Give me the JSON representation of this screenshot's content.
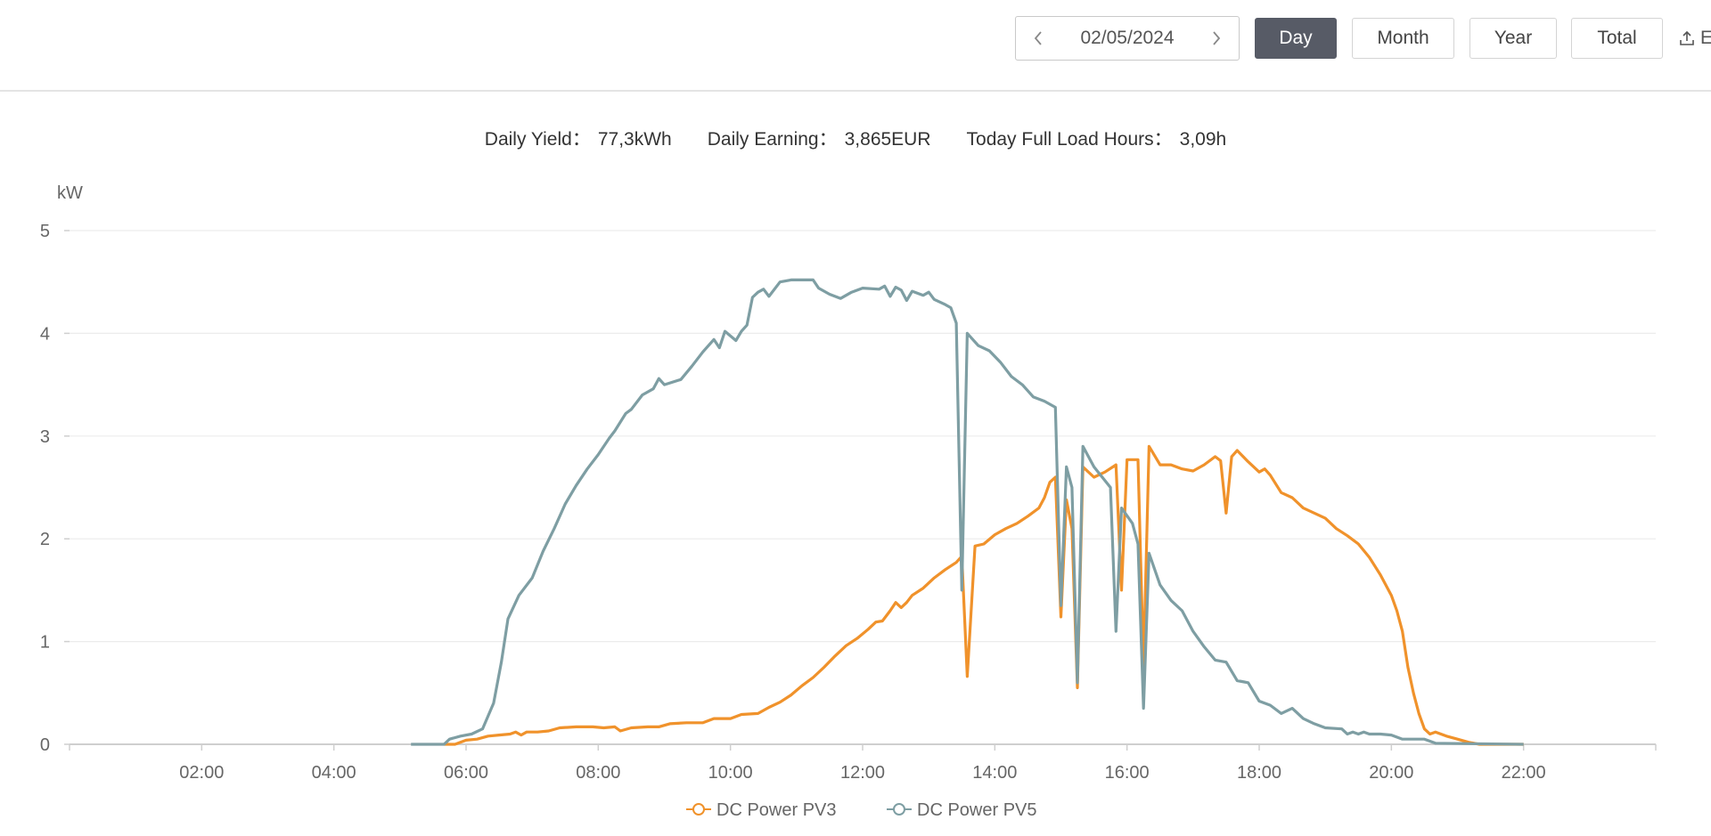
{
  "toolbar": {
    "date": "02/05/2024",
    "buttons": {
      "day": "Day",
      "month": "Month",
      "year": "Year",
      "total": "Total"
    },
    "export_label": "E"
  },
  "summary": {
    "daily_yield_label": "Daily Yield：",
    "daily_yield_value": "77,3kWh",
    "daily_earning_label": "Daily Earning：",
    "daily_earning_value": "3,865EUR",
    "full_load_label": "Today Full Load Hours：",
    "full_load_value": "3,09h"
  },
  "colors": {
    "pv3": "#f0922b",
    "pv5": "#7e9ea3",
    "active_button": "#575b66"
  },
  "chart_data": {
    "type": "line",
    "ylabel": "kW",
    "ylim": [
      0,
      5
    ],
    "yticks": [
      0,
      1,
      2,
      3,
      4,
      5
    ],
    "xlim": [
      "00:00",
      "24:00"
    ],
    "xticks": [
      "02:00",
      "04:00",
      "06:00",
      "08:00",
      "10:00",
      "12:00",
      "14:00",
      "16:00",
      "18:00",
      "20:00",
      "22:00"
    ],
    "grid": true,
    "legend_position": "bottom",
    "series": [
      {
        "name": "DC Power PV3",
        "color": "#f0922b",
        "points": [
          [
            "05:40",
            0.0
          ],
          [
            "05:50",
            0.0
          ],
          [
            "06:00",
            0.04
          ],
          [
            "06:10",
            0.05
          ],
          [
            "06:20",
            0.08
          ],
          [
            "06:30",
            0.09
          ],
          [
            "06:40",
            0.1
          ],
          [
            "06:45",
            0.12
          ],
          [
            "06:50",
            0.09
          ],
          [
            "06:55",
            0.12
          ],
          [
            "07:05",
            0.12
          ],
          [
            "07:15",
            0.13
          ],
          [
            "07:25",
            0.16
          ],
          [
            "07:40",
            0.17
          ],
          [
            "07:55",
            0.17
          ],
          [
            "08:05",
            0.16
          ],
          [
            "08:15",
            0.17
          ],
          [
            "08:20",
            0.13
          ],
          [
            "08:30",
            0.16
          ],
          [
            "08:45",
            0.17
          ],
          [
            "08:55",
            0.17
          ],
          [
            "09:05",
            0.2
          ],
          [
            "09:20",
            0.21
          ],
          [
            "09:35",
            0.21
          ],
          [
            "09:45",
            0.25
          ],
          [
            "10:00",
            0.25
          ],
          [
            "10:10",
            0.29
          ],
          [
            "10:25",
            0.3
          ],
          [
            "10:35",
            0.36
          ],
          [
            "10:45",
            0.41
          ],
          [
            "10:55",
            0.48
          ],
          [
            "11:05",
            0.57
          ],
          [
            "11:15",
            0.65
          ],
          [
            "11:25",
            0.75
          ],
          [
            "11:35",
            0.86
          ],
          [
            "11:45",
            0.96
          ],
          [
            "11:55",
            1.03
          ],
          [
            "12:05",
            1.12
          ],
          [
            "12:12",
            1.19
          ],
          [
            "12:18",
            1.2
          ],
          [
            "12:25",
            1.3
          ],
          [
            "12:30",
            1.38
          ],
          [
            "12:35",
            1.33
          ],
          [
            "12:40",
            1.38
          ],
          [
            "12:45",
            1.45
          ],
          [
            "12:55",
            1.52
          ],
          [
            "13:05",
            1.62
          ],
          [
            "13:15",
            1.7
          ],
          [
            "13:25",
            1.77
          ],
          [
            "13:30",
            1.83
          ],
          [
            "13:35",
            0.66
          ],
          [
            "13:42",
            1.93
          ],
          [
            "13:50",
            1.95
          ],
          [
            "14:00",
            2.04
          ],
          [
            "14:10",
            2.1
          ],
          [
            "14:20",
            2.15
          ],
          [
            "14:30",
            2.22
          ],
          [
            "14:40",
            2.3
          ],
          [
            "14:45",
            2.4
          ],
          [
            "14:50",
            2.55
          ],
          [
            "14:55",
            2.6
          ],
          [
            "15:00",
            1.24
          ],
          [
            "15:05",
            2.38
          ],
          [
            "15:10",
            2.1
          ],
          [
            "15:15",
            0.55
          ],
          [
            "15:20",
            2.7
          ],
          [
            "15:30",
            2.6
          ],
          [
            "15:40",
            2.65
          ],
          [
            "15:50",
            2.72
          ],
          [
            "15:55",
            1.5
          ],
          [
            "16:00",
            2.77
          ],
          [
            "16:10",
            2.77
          ],
          [
            "16:15",
            0.75
          ],
          [
            "16:20",
            2.9
          ],
          [
            "16:30",
            2.72
          ],
          [
            "16:40",
            2.72
          ],
          [
            "16:50",
            2.68
          ],
          [
            "17:00",
            2.66
          ],
          [
            "17:10",
            2.72
          ],
          [
            "17:20",
            2.8
          ],
          [
            "17:25",
            2.76
          ],
          [
            "17:30",
            2.25
          ],
          [
            "17:35",
            2.8
          ],
          [
            "17:40",
            2.86
          ],
          [
            "17:50",
            2.75
          ],
          [
            "18:00",
            2.65
          ],
          [
            "18:05",
            2.68
          ],
          [
            "18:10",
            2.62
          ],
          [
            "18:20",
            2.45
          ],
          [
            "18:30",
            2.4
          ],
          [
            "18:40",
            2.3
          ],
          [
            "18:50",
            2.25
          ],
          [
            "19:00",
            2.2
          ],
          [
            "19:10",
            2.1
          ],
          [
            "19:20",
            2.03
          ],
          [
            "19:30",
            1.95
          ],
          [
            "19:40",
            1.82
          ],
          [
            "19:50",
            1.65
          ],
          [
            "20:00",
            1.45
          ],
          [
            "20:05",
            1.3
          ],
          [
            "20:10",
            1.1
          ],
          [
            "20:15",
            0.75
          ],
          [
            "20:20",
            0.5
          ],
          [
            "20:25",
            0.3
          ],
          [
            "20:30",
            0.15
          ],
          [
            "20:35",
            0.1
          ],
          [
            "20:40",
            0.12
          ],
          [
            "20:50",
            0.08
          ],
          [
            "21:00",
            0.05
          ],
          [
            "21:10",
            0.02
          ],
          [
            "21:20",
            0.0
          ],
          [
            "22:00",
            0.0
          ]
        ]
      },
      {
        "name": "DC Power PV5",
        "color": "#7e9ea3",
        "points": [
          [
            "05:10",
            0.0
          ],
          [
            "05:40",
            0.0
          ],
          [
            "05:45",
            0.05
          ],
          [
            "05:55",
            0.08
          ],
          [
            "06:05",
            0.1
          ],
          [
            "06:15",
            0.15
          ],
          [
            "06:25",
            0.4
          ],
          [
            "06:32",
            0.8
          ],
          [
            "06:38",
            1.22
          ],
          [
            "06:48",
            1.45
          ],
          [
            "07:00",
            1.62
          ],
          [
            "07:10",
            1.88
          ],
          [
            "07:20",
            2.1
          ],
          [
            "07:30",
            2.34
          ],
          [
            "07:40",
            2.52
          ],
          [
            "07:50",
            2.68
          ],
          [
            "08:00",
            2.82
          ],
          [
            "08:10",
            2.98
          ],
          [
            "08:15",
            3.05
          ],
          [
            "08:25",
            3.22
          ],
          [
            "08:30",
            3.26
          ],
          [
            "08:40",
            3.4
          ],
          [
            "08:50",
            3.46
          ],
          [
            "08:55",
            3.56
          ],
          [
            "09:00",
            3.5
          ],
          [
            "09:15",
            3.55
          ],
          [
            "09:25",
            3.68
          ],
          [
            "09:35",
            3.82
          ],
          [
            "09:45",
            3.94
          ],
          [
            "09:50",
            3.86
          ],
          [
            "09:55",
            4.02
          ],
          [
            "10:05",
            3.93
          ],
          [
            "10:10",
            4.02
          ],
          [
            "10:15",
            4.08
          ],
          [
            "10:20",
            4.35
          ],
          [
            "10:25",
            4.4
          ],
          [
            "10:30",
            4.43
          ],
          [
            "10:35",
            4.36
          ],
          [
            "10:45",
            4.5
          ],
          [
            "10:55",
            4.52
          ],
          [
            "11:15",
            4.52
          ],
          [
            "11:20",
            4.44
          ],
          [
            "11:30",
            4.38
          ],
          [
            "11:40",
            4.34
          ],
          [
            "11:50",
            4.4
          ],
          [
            "12:00",
            4.44
          ],
          [
            "12:15",
            4.43
          ],
          [
            "12:20",
            4.46
          ],
          [
            "12:25",
            4.36
          ],
          [
            "12:30",
            4.45
          ],
          [
            "12:35",
            4.42
          ],
          [
            "12:40",
            4.32
          ],
          [
            "12:45",
            4.41
          ],
          [
            "12:55",
            4.37
          ],
          [
            "13:00",
            4.4
          ],
          [
            "13:05",
            4.33
          ],
          [
            "13:15",
            4.28
          ],
          [
            "13:20",
            4.25
          ],
          [
            "13:25",
            4.1
          ],
          [
            "13:30",
            1.5
          ],
          [
            "13:35",
            4.0
          ],
          [
            "13:45",
            3.88
          ],
          [
            "13:55",
            3.83
          ],
          [
            "14:05",
            3.72
          ],
          [
            "14:15",
            3.58
          ],
          [
            "14:25",
            3.5
          ],
          [
            "14:35",
            3.38
          ],
          [
            "14:45",
            3.34
          ],
          [
            "14:55",
            3.28
          ],
          [
            "15:00",
            1.35
          ],
          [
            "15:05",
            2.7
          ],
          [
            "15:10",
            2.5
          ],
          [
            "15:15",
            0.6
          ],
          [
            "15:20",
            2.9
          ],
          [
            "15:30",
            2.7
          ],
          [
            "15:45",
            2.5
          ],
          [
            "15:50",
            1.1
          ],
          [
            "15:55",
            2.3
          ],
          [
            "16:05",
            2.15
          ],
          [
            "16:10",
            1.95
          ],
          [
            "16:15",
            0.35
          ],
          [
            "16:20",
            1.86
          ],
          [
            "16:30",
            1.55
          ],
          [
            "16:40",
            1.4
          ],
          [
            "16:50",
            1.3
          ],
          [
            "17:00",
            1.1
          ],
          [
            "17:10",
            0.95
          ],
          [
            "17:20",
            0.82
          ],
          [
            "17:30",
            0.8
          ],
          [
            "17:40",
            0.62
          ],
          [
            "17:50",
            0.6
          ],
          [
            "18:00",
            0.42
          ],
          [
            "18:10",
            0.38
          ],
          [
            "18:20",
            0.3
          ],
          [
            "18:30",
            0.35
          ],
          [
            "18:40",
            0.25
          ],
          [
            "18:50",
            0.2
          ],
          [
            "19:00",
            0.16
          ],
          [
            "19:15",
            0.15
          ],
          [
            "19:20",
            0.1
          ],
          [
            "19:25",
            0.12
          ],
          [
            "19:30",
            0.1
          ],
          [
            "19:35",
            0.12
          ],
          [
            "19:40",
            0.1
          ],
          [
            "19:50",
            0.1
          ],
          [
            "20:00",
            0.09
          ],
          [
            "20:10",
            0.05
          ],
          [
            "20:30",
            0.05
          ],
          [
            "20:40",
            0.01
          ],
          [
            "22:00",
            0.0
          ]
        ]
      }
    ]
  }
}
